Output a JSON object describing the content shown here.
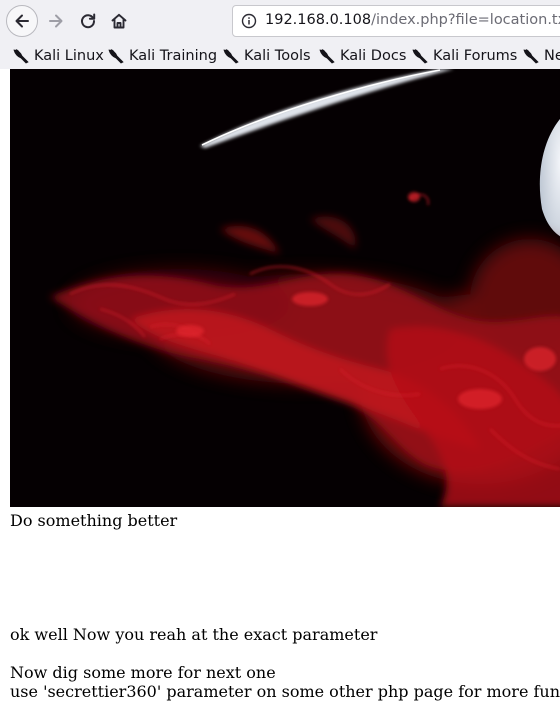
{
  "browser": {
    "url_host": "192.168.0.108",
    "url_path": "/index.php?file=location.txt"
  },
  "bookmarks": [
    {
      "label": "Kali Linux",
      "icon": "kali-dragon-icon"
    },
    {
      "label": "Kali Training",
      "icon": "kali-dragon-icon"
    },
    {
      "label": "Kali Tools",
      "icon": "kali-dragon-icon"
    },
    {
      "label": "Kali Docs",
      "icon": "kali-dragon-icon"
    },
    {
      "label": "Kali Forums",
      "icon": "kali-dragon-icon"
    },
    {
      "label": "Ne",
      "icon": "kali-dragon-icon"
    }
  ],
  "page": {
    "line1": "Do something better",
    "line2": "ok well Now you reah at the exact parameter",
    "line3": "Now dig some more for next one",
    "line4": "use 'secrettier360' parameter on some other php page for more fun."
  },
  "colors": {
    "hero_background": "#050002",
    "smoke": "#b3121a",
    "toolbar": "#f0f0f4"
  }
}
